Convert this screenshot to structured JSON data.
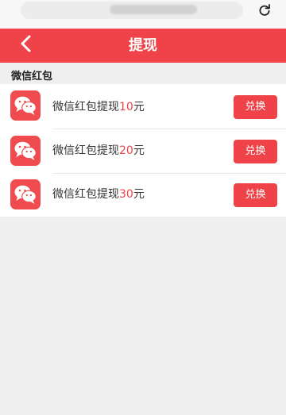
{
  "browser": {
    "url": "",
    "refresh_icon": "refresh-icon"
  },
  "header": {
    "title": "提现",
    "back_icon": "chevron-left-icon",
    "color": "#ef4349"
  },
  "section": {
    "label": "微信红包"
  },
  "items": [
    {
      "label": "微信红包提现",
      "amount": "10",
      "unit": "元",
      "button": "兑换",
      "icon": "wechat-icon"
    },
    {
      "label": "微信红包提现",
      "amount": "20",
      "unit": "元",
      "button": "兑换",
      "icon": "wechat-icon"
    },
    {
      "label": "微信红包提现",
      "amount": "30",
      "unit": "元",
      "button": "兑换",
      "icon": "wechat-icon"
    }
  ]
}
